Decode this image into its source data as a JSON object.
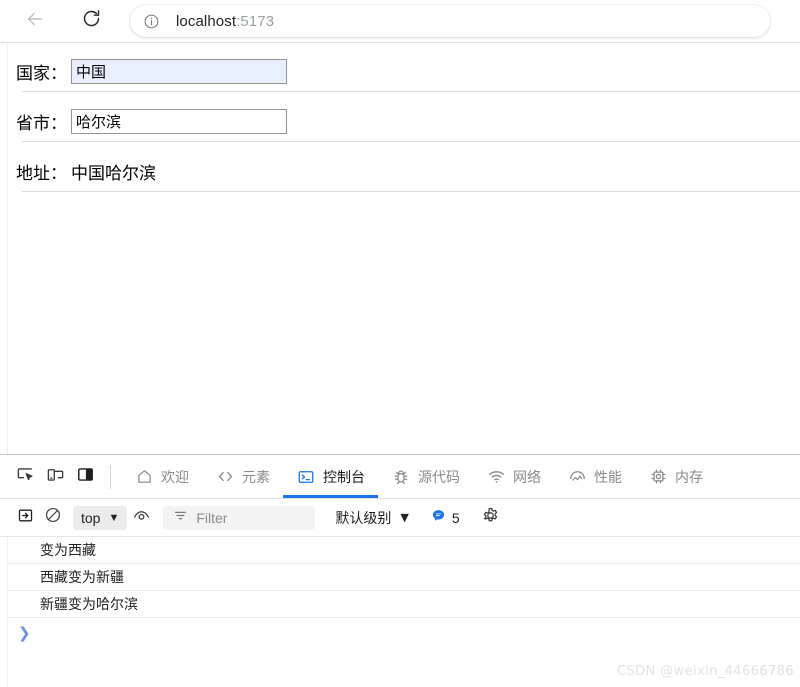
{
  "browser": {
    "back_icon": "back-arrow-icon",
    "reload_icon": "reload-icon",
    "info_icon": "site-info-icon",
    "url_host": "localhost",
    "url_port": ":5173"
  },
  "page": {
    "rows": [
      {
        "label": "国家：",
        "value": "中国",
        "type": "input",
        "autofilled": true
      },
      {
        "label": "省市：",
        "value": "哈尔滨",
        "type": "input",
        "autofilled": false
      },
      {
        "label": "地址：",
        "value": "中国哈尔滨",
        "type": "text"
      }
    ]
  },
  "devtools": {
    "tools": [
      {
        "name": "inspect-element-icon"
      },
      {
        "name": "device-toolbar-icon"
      },
      {
        "name": "dock-panel-icon"
      }
    ],
    "tabs": [
      {
        "label": "欢迎",
        "icon": "home-icon",
        "active": false
      },
      {
        "label": "元素",
        "icon": "code-brackets-icon",
        "active": false
      },
      {
        "label": "控制台",
        "icon": "console-terminal-icon",
        "active": true
      },
      {
        "label": "源代码",
        "icon": "bug-icon",
        "active": false
      },
      {
        "label": "网络",
        "icon": "wifi-icon",
        "active": false
      },
      {
        "label": "性能",
        "icon": "performance-gauge-icon",
        "active": false
      },
      {
        "label": "内存",
        "icon": "memory-chip-icon",
        "active": false
      }
    ],
    "toolbar": {
      "sidebar_toggle_icon": "console-sidebar-icon",
      "clear_icon": "clear-console-icon",
      "context_label": "top",
      "context_caret": "▼",
      "eye_icon": "live-expression-eye-icon",
      "filter_icon": "filter-icon",
      "filter_placeholder": "Filter",
      "level_label": "默认级别",
      "level_caret": "▼",
      "message_badge_icon": "info-message-icon",
      "message_count": "5",
      "settings_icon": "gear-icon"
    },
    "console_logs": [
      "变为西藏",
      "西藏变为新疆",
      "新疆变为哈尔滨"
    ],
    "prompt_symbol": "❯"
  },
  "watermark": "CSDN @weixin_44666786",
  "colors": {
    "accent": "#1a73e8",
    "autofill": "#e8f0fe",
    "prompt": "#6b8fe8",
    "badge": "#1a73e8"
  }
}
